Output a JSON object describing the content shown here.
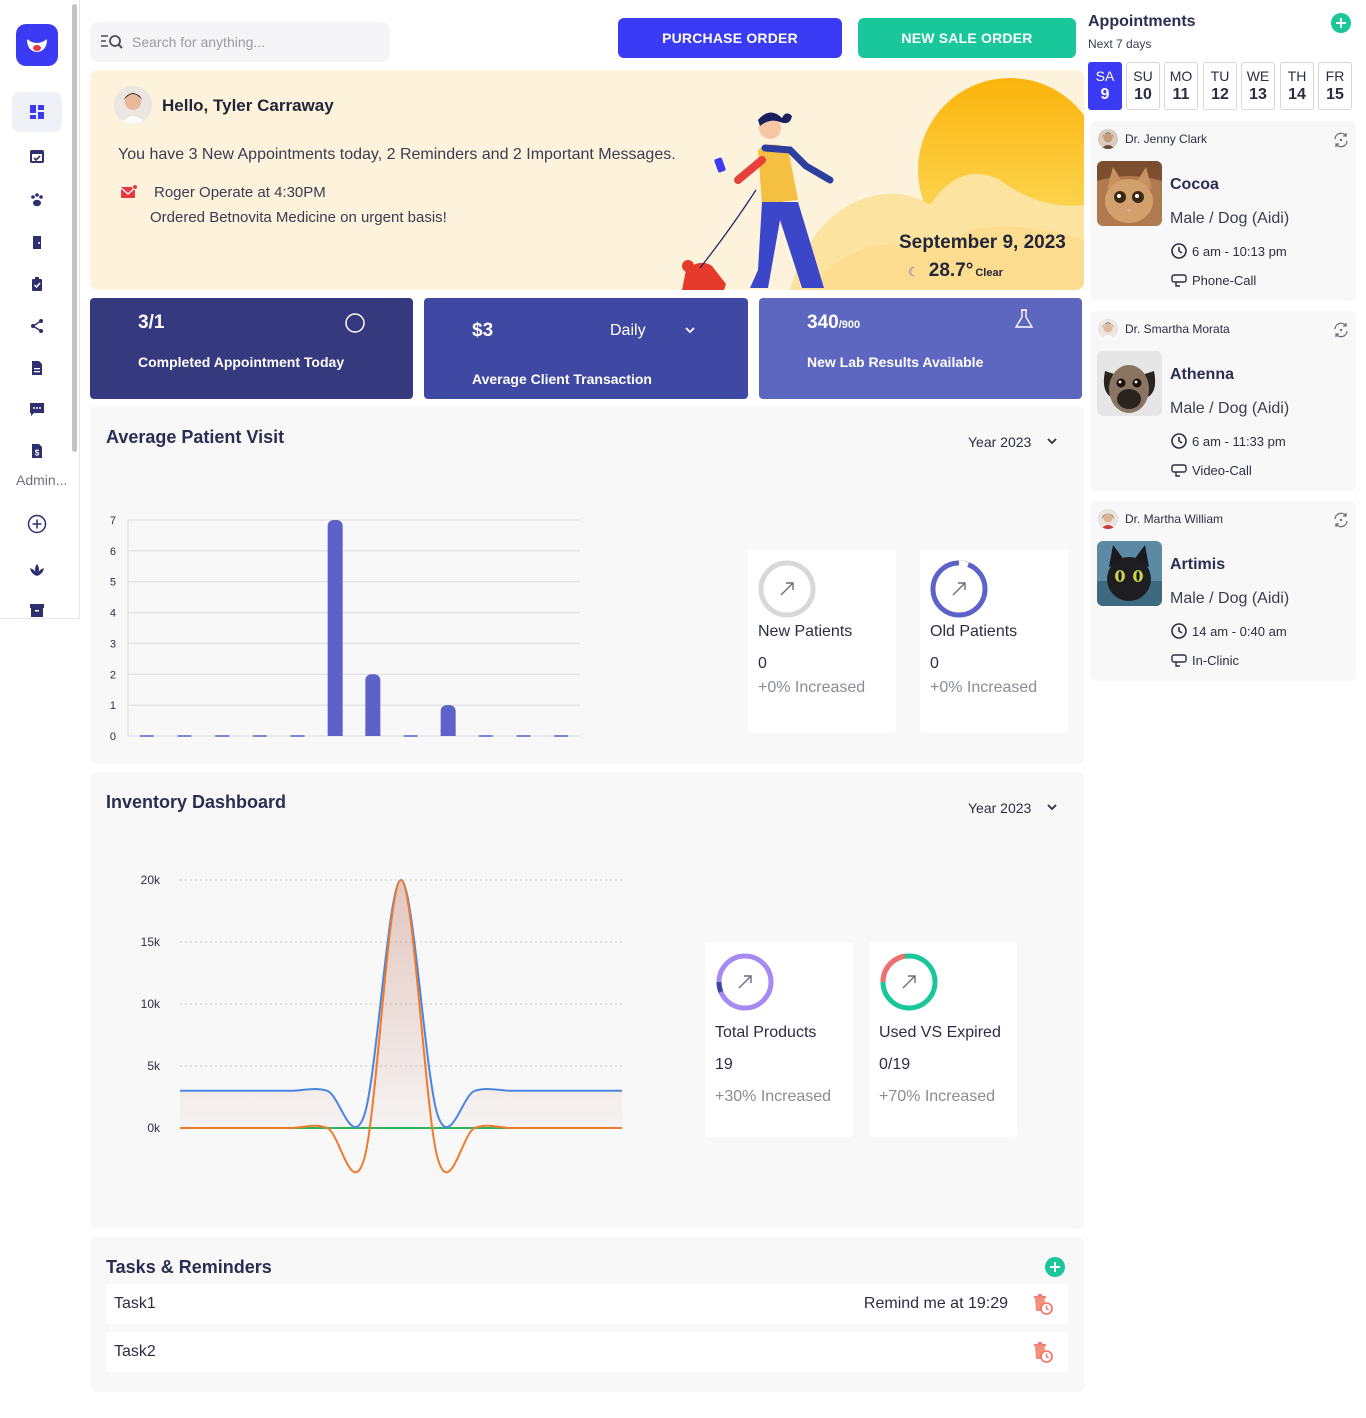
{
  "sidebar": {
    "admin_label": "Admin...",
    "items": [
      "dashboard-icon",
      "calendar-check-icon",
      "paw-icon",
      "door-icon",
      "clipboard-check-icon",
      "share-icon",
      "document-icon",
      "chat-icon",
      "invoice-icon"
    ]
  },
  "search": {
    "placeholder": "Search for anything..."
  },
  "actions": {
    "purchase_order": "PURCHASE ORDER",
    "new_sale_order": "NEW SALE ORDER"
  },
  "colors": {
    "primary": "#3b3bf5",
    "green": "#19c79b",
    "card1": "#35397e",
    "card2": "#3f48a2",
    "card3": "#5e67c0",
    "bar": "#5c62c8"
  },
  "banner": {
    "greeting": "Hello, Tyler Carraway",
    "message": "You have 3 New Appointments today, 2 Reminders and 2 Important Messages.",
    "reminder_title": "Roger Operate at 4:30PM",
    "reminder_desc": "Ordered Betnovita Medicine on urgent basis!",
    "date": "September 9, 2023",
    "temperature": "28.7°",
    "condition": "Clear"
  },
  "stats": {
    "completed": {
      "value": "3/1",
      "label": "Completed Appointment Today"
    },
    "transaction": {
      "value": "$3",
      "period": "Daily",
      "label": "Average Client Transaction"
    },
    "lab": {
      "value": "340",
      "total": "/900",
      "label": "New Lab Results Available"
    }
  },
  "patient_visit": {
    "title": "Average Patient Visit",
    "year": "Year 2023",
    "new_patients": {
      "title": "New Patients",
      "value": "0",
      "change": "+0% Increased"
    },
    "old_patients": {
      "title": "Old Patients",
      "value": "0",
      "change": "+0% Increased"
    }
  },
  "inventory": {
    "title": "Inventory Dashboard",
    "year": "Year 2023",
    "total_products": {
      "title": "Total Products",
      "value": "19",
      "change": "+30% Increased"
    },
    "used_vs_expired": {
      "title": "Used VS Expired",
      "value": "0/19",
      "change": "+70% Increased"
    }
  },
  "tasks": {
    "title": "Tasks & Reminders",
    "items": [
      {
        "name": "Task1",
        "remind": "Remind me at 19:29"
      },
      {
        "name": "Task2",
        "remind": ""
      }
    ]
  },
  "appointments": {
    "title": "Appointments",
    "subtitle": "Next 7 days",
    "days": [
      {
        "name": "SA",
        "num": "9"
      },
      {
        "name": "SU",
        "num": "10"
      },
      {
        "name": "MO",
        "num": "11"
      },
      {
        "name": "TU",
        "num": "12"
      },
      {
        "name": "WE",
        "num": "13"
      },
      {
        "name": "TH",
        "num": "14"
      },
      {
        "name": "FR",
        "num": "15"
      }
    ],
    "items": [
      {
        "doctor": "Dr. Jenny Clark",
        "pet": "Cocoa",
        "info": "Male / Dog (Aidi)",
        "time": "6 am - 10:13 pm",
        "type": "Phone-Call"
      },
      {
        "doctor": "Dr. Smartha Morata",
        "pet": "Athenna",
        "info": "Male / Dog (Aidi)",
        "time": "6 am - 11:33 pm",
        "type": "Video-Call"
      },
      {
        "doctor": "Dr. Martha William",
        "pet": "Artimis",
        "info": "Male / Dog (Aidi)",
        "time": "14 am - 0:40 am",
        "type": "In-Clinic"
      }
    ]
  },
  "chart_data": [
    {
      "type": "bar",
      "categories": [
        "",
        "",
        "",
        "",
        "",
        "",
        "",
        "",
        "",
        "",
        "",
        ""
      ],
      "values": [
        0,
        0,
        0,
        0,
        0,
        7,
        2,
        0,
        1,
        0,
        0,
        0
      ],
      "ylim": [
        0,
        7
      ],
      "yticks": [
        "0",
        "1",
        "2",
        "3",
        "4",
        "5",
        "6",
        "7"
      ],
      "grid": true
    },
    {
      "type": "line",
      "x": [
        0,
        1,
        2,
        3,
        4,
        5,
        6,
        7,
        8,
        9,
        10,
        11,
        12
      ],
      "ylim": [
        0,
        20000
      ],
      "yticks": [
        "0k",
        "5k",
        "10k",
        "15k",
        "20k"
      ],
      "series": [
        {
          "color": "#4a86e0",
          "values": [
            3000,
            3000,
            3000,
            3000,
            3000,
            1000,
            20000,
            1000,
            3000,
            3000,
            3000,
            3000,
            3000
          ]
        },
        {
          "color": "#ee7a2c",
          "values": [
            0,
            0,
            0,
            0,
            0,
            -2500,
            20000,
            -2500,
            0,
            0,
            0,
            0,
            0
          ]
        },
        {
          "color": "#33b35a",
          "values": [
            0,
            0,
            0,
            0,
            0,
            0,
            0,
            0,
            0,
            0,
            0,
            0,
            0
          ]
        }
      ]
    }
  ]
}
